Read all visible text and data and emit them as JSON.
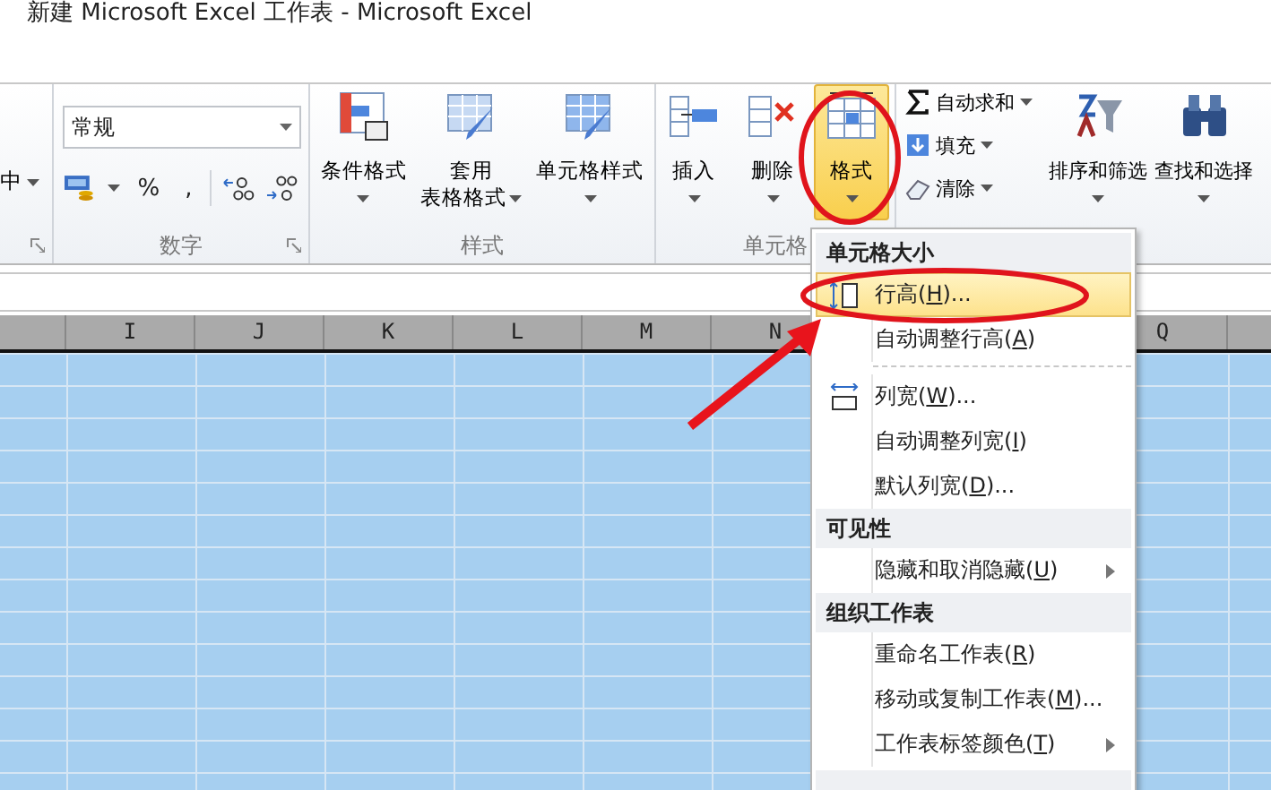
{
  "window": {
    "title": "新建 Microsoft Excel 工作表  -  Microsoft Excel"
  },
  "ribbon": {
    "groups": [
      {
        "kind": "align",
        "items": [
          {
            "label": "中"
          }
        ]
      },
      {
        "kind": "number",
        "label": "数字",
        "format": "常规",
        "buttons": [
          {
            "kind": "currency"
          },
          {
            "kind": "text",
            "label": "%"
          },
          {
            "kind": "text",
            "label": ","
          },
          {
            "kind": "increase"
          },
          {
            "kind": "decrease"
          }
        ]
      },
      {
        "kind": "large",
        "label": "样式",
        "items": [
          {
            "kind": "conditional",
            "label": "条件格式",
            "selected": false
          },
          {
            "kind": "table",
            "label": "套用",
            "label2": "表格格式",
            "selected": false
          },
          {
            "kind": "cellstyle",
            "label": "单元格样式",
            "selected": false
          }
        ]
      },
      {
        "kind": "large",
        "label": "单元格",
        "items": [
          {
            "kind": "insert",
            "label": "插入",
            "selected": false
          },
          {
            "kind": "delete",
            "label": "删除",
            "selected": false
          },
          {
            "kind": "format",
            "label": "格式",
            "selected": true
          }
        ]
      },
      {
        "kind": "edit",
        "small": [
          {
            "kind": "sum",
            "label": "自动求和"
          },
          {
            "kind": "fill",
            "label": "填充"
          },
          {
            "kind": "clear",
            "label": "清除"
          }
        ],
        "items": [
          {
            "kind": "sort",
            "label": "排序和筛选",
            "selected": false
          },
          {
            "kind": "find",
            "label": "查找和选择",
            "selected": false
          }
        ]
      }
    ]
  },
  "grid": {
    "columns_left": [
      "I",
      "J",
      "K",
      "L",
      "M",
      "N"
    ],
    "columns_right": [
      "Q"
    ]
  },
  "menu": {
    "items": [
      {
        "kind": "header",
        "label": "单元格大小"
      },
      {
        "kind": "item",
        "before": "行高(",
        "key": "H",
        "after": ")...",
        "selected": true,
        "submenu": false
      },
      {
        "kind": "item",
        "before": "自动调整行高(",
        "key": "A",
        "after": ")",
        "selected": false,
        "submenu": false
      },
      {
        "kind": "separator"
      },
      {
        "kind": "item",
        "before": "列宽(",
        "key": "W",
        "after": ")...",
        "selected": false,
        "submenu": false
      },
      {
        "kind": "item",
        "before": "自动调整列宽(",
        "key": "I",
        "after": ")",
        "selected": false,
        "submenu": false
      },
      {
        "kind": "item",
        "before": "默认列宽(",
        "key": "D",
        "after": ")...",
        "selected": false,
        "submenu": false
      },
      {
        "kind": "header",
        "label": "可见性"
      },
      {
        "kind": "item",
        "before": "隐藏和取消隐藏(",
        "key": "U",
        "after": ")",
        "selected": false,
        "submenu": true
      },
      {
        "kind": "header",
        "label": "组织工作表"
      },
      {
        "kind": "item",
        "before": "重命名工作表(",
        "key": "R",
        "after": ")",
        "selected": false,
        "submenu": false
      },
      {
        "kind": "item",
        "before": "移动或复制工作表(",
        "key": "M",
        "after": ")...",
        "selected": false,
        "submenu": false
      },
      {
        "kind": "item",
        "before": "工作表标签颜色(",
        "key": "T",
        "after": ")",
        "selected": false,
        "submenu": true
      }
    ]
  }
}
